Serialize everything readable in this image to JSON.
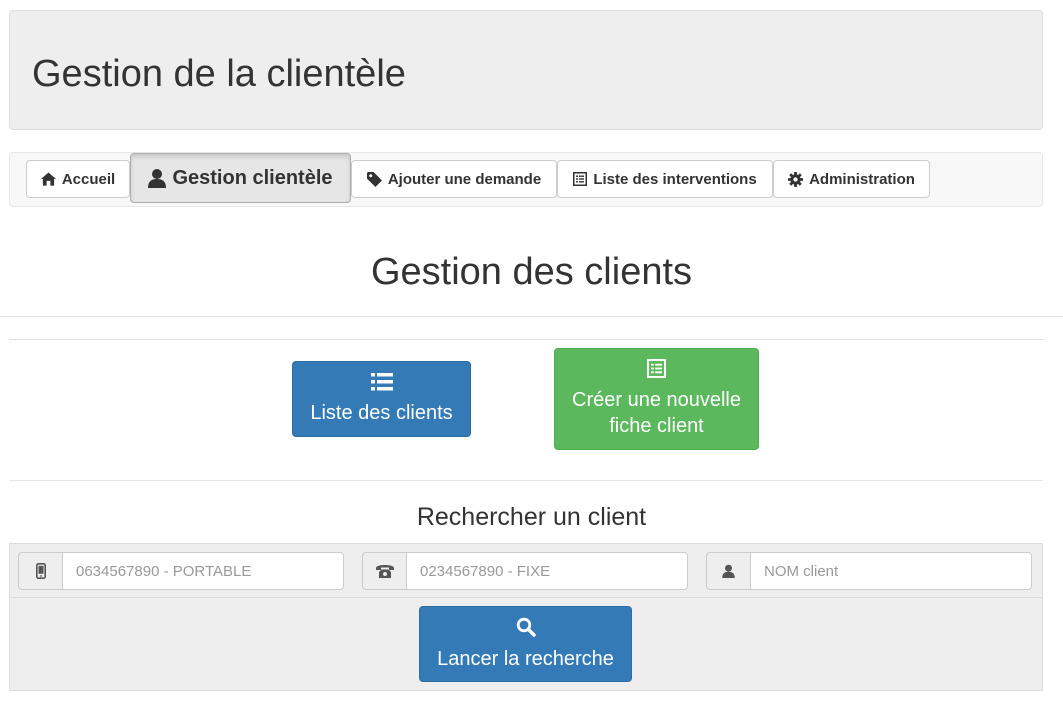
{
  "header": {
    "title": "Gestion de la clientèle"
  },
  "nav": {
    "items": [
      {
        "label": "Accueil",
        "icon": "home-icon"
      },
      {
        "label": "Gestion clientèle",
        "icon": "user-icon",
        "active": true
      },
      {
        "label": "Ajouter une demande",
        "icon": "tag-icon"
      },
      {
        "label": "Liste des interventions",
        "icon": "list-alt-icon"
      },
      {
        "label": "Administration",
        "icon": "cog-icon"
      }
    ]
  },
  "main": {
    "title": "Gestion des clients",
    "list_button": {
      "label": "Liste des clients",
      "icon": "list-icon"
    },
    "create_button": {
      "line1": "Créer une nouvelle",
      "line2": "fiche client",
      "icon": "list-alt-icon"
    }
  },
  "search": {
    "title": "Rechercher un client",
    "mobile": {
      "placeholder": "0634567890 - PORTABLE",
      "icon": "phone-icon"
    },
    "landline": {
      "placeholder": "0234567890 - FIXE",
      "icon": "telephone-icon"
    },
    "name": {
      "placeholder": "NOM client",
      "icon": "user-icon"
    },
    "submit": {
      "label": "Lancer la recherche",
      "icon": "search-icon"
    }
  },
  "colors": {
    "primary": "#337ab7",
    "success": "#5cb85c",
    "well": "#eeeeee",
    "text": "#333333"
  }
}
